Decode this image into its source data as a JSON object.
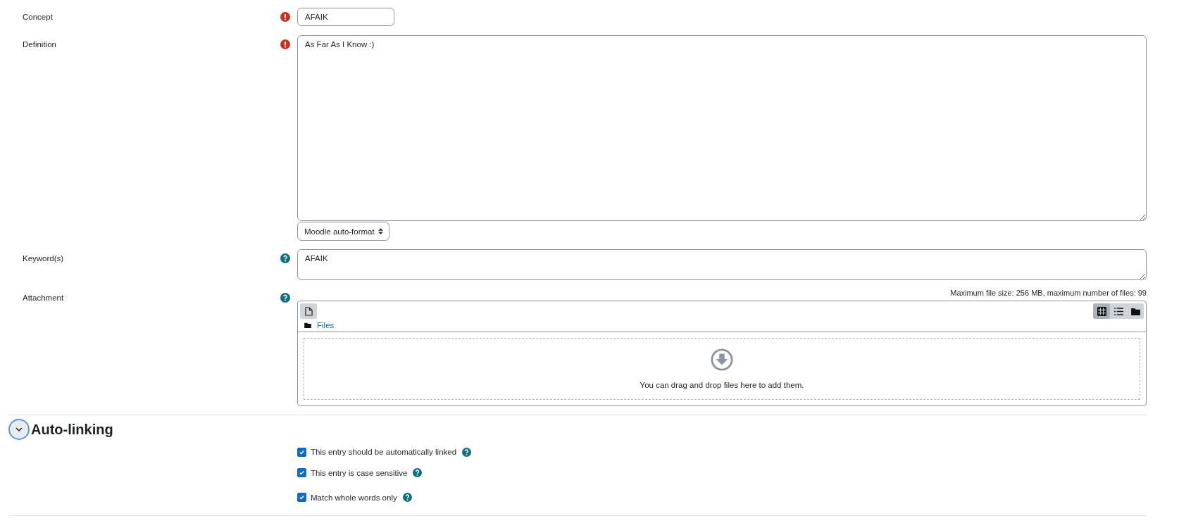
{
  "fields": [
    {
      "kind": "text",
      "label": "Concept",
      "marker": {
        "kind": "required"
      },
      "value": "AFAIK"
    },
    {
      "kind": "editor",
      "label": "Definition",
      "marker": {
        "kind": "required"
      },
      "value": "As Far As I Know :)",
      "format": "Moodle auto-format"
    },
    {
      "kind": "textarea",
      "label": "Keyword(s)",
      "marker": {
        "kind": "help"
      },
      "value": "AFAIK"
    },
    {
      "kind": "filepicker",
      "label": "Attachment",
      "marker": {
        "kind": "help"
      },
      "limits": "Maximum file size: 256 MB, maximum number of files: 99",
      "path": "Files",
      "views": [
        {
          "kind": "icons",
          "selected": true
        },
        {
          "kind": "list",
          "selected": false
        },
        {
          "kind": "tree",
          "selected": false
        }
      ],
      "drop_hint": "You can drag and drop files here to add them."
    }
  ],
  "section": {
    "title": "Auto-linking",
    "expanded": true,
    "options": [
      {
        "label": "This entry should be automatically linked",
        "checked": true
      },
      {
        "label": "This entry is case sensitive",
        "checked": true
      },
      {
        "label": "Match whole words only",
        "checked": true
      }
    ]
  }
}
